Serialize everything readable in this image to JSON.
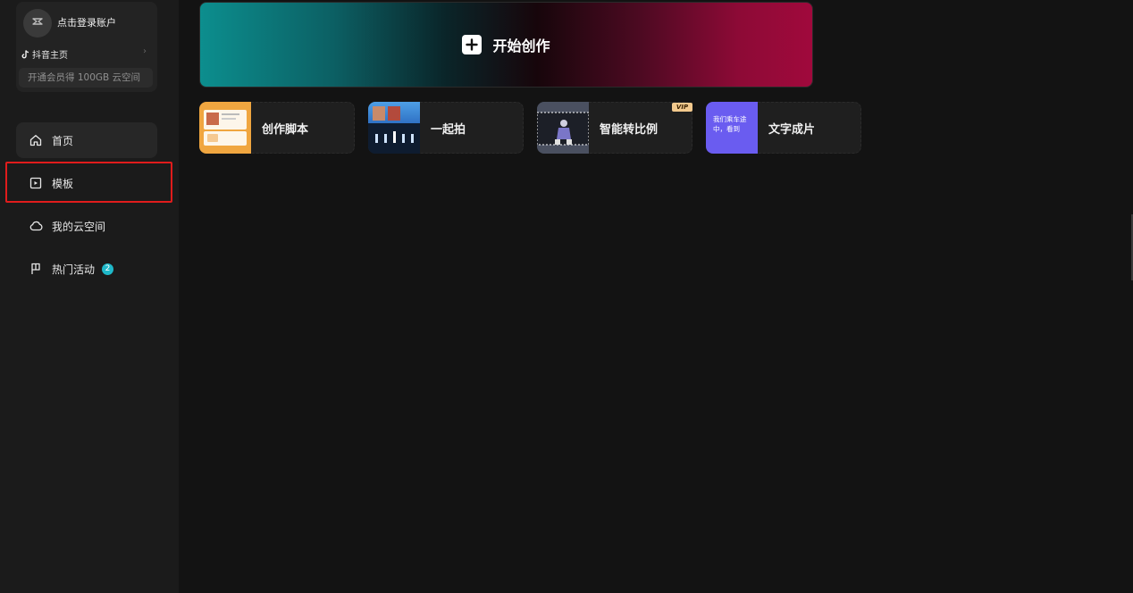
{
  "sidebar": {
    "account": {
      "login_label": "点击登录账户",
      "douyin_label": "抖音主页",
      "vip_promo": "开通会员得 100GB 云空间"
    },
    "nav": [
      {
        "label": "首页",
        "icon": "home-icon"
      },
      {
        "label": "模板",
        "icon": "template-icon"
      },
      {
        "label": "我的云空间",
        "icon": "cloud-icon"
      },
      {
        "label": "热门活动",
        "icon": "flag-icon",
        "badge": "2"
      }
    ],
    "active_index": 0,
    "highlighted_index": 1,
    "highlight_color": "#e01c1c"
  },
  "main": {
    "hero": {
      "label": "开始创作",
      "icon": "plus-icon"
    },
    "tools": [
      {
        "label": "创作脚本",
        "thumb_theme": "#f0a640"
      },
      {
        "label": "一起拍",
        "thumb_theme": "#3a8fd6"
      },
      {
        "label": "智能转比例",
        "thumb_theme": "#3a3f55",
        "badge": "VIP"
      },
      {
        "label": "文字成片",
        "thumb_theme": "#6a5cf0",
        "thumb_text": "我们乘车途中，看到"
      }
    ]
  },
  "colors": {
    "badge": "#1fb8c9",
    "vip": "#f2c98d",
    "hero_left": "#0c8e8e",
    "hero_right": "#a0093c"
  }
}
